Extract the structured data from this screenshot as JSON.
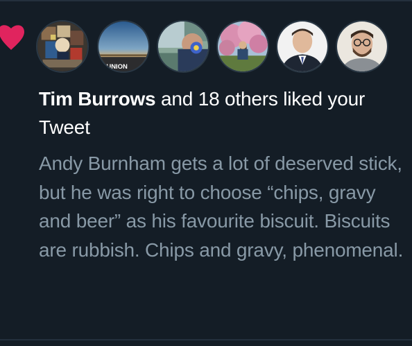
{
  "notification": {
    "type": "like",
    "liker_name": "Tim Burrows",
    "liked_summary": " and 18 others liked your Tweet"
  },
  "avatars": [
    {
      "label": "avatar-collage"
    },
    {
      "label": "avatar-sunset",
      "caption": "UNION"
    },
    {
      "label": "avatar-flower-face"
    },
    {
      "label": "avatar-blossom-tree"
    },
    {
      "label": "avatar-man-suit"
    },
    {
      "label": "avatar-man-glasses"
    }
  ],
  "tweet": {
    "text": "Andy Burnham gets a lot of deserved stick, but he was right to choose “chips, gravy and beer” as his favourite biscuit. Biscuits are rubbish. Chips and gravy, phenomenal."
  },
  "colors": {
    "background": "#141d26",
    "heart": "#e0245e",
    "name_text": "#ffffff",
    "tweet_text": "#8899a6"
  }
}
